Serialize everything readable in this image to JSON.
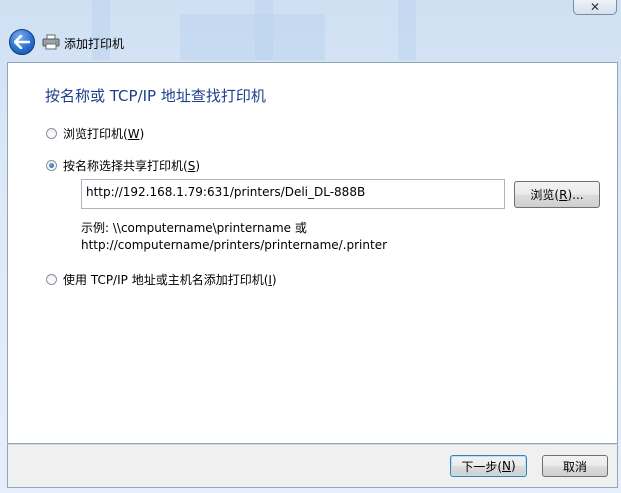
{
  "window": {
    "title": "添加打印机",
    "close_glyph": "✕"
  },
  "icons": {
    "back": "back-arrow-icon",
    "printer": "printer-icon",
    "close": "close-icon"
  },
  "colors": {
    "heading": "#1e3f8a",
    "accent": "#2a6fd1",
    "glass": "#dde9f7"
  },
  "main": {
    "heading": "按名称或 TCP/IP 地址查找打印机",
    "options": [
      {
        "label": "浏览打印机(",
        "key": "W",
        "suffix": ")",
        "checked": false
      },
      {
        "label": "按名称选择共享打印机(",
        "key": "S",
        "suffix": ")",
        "checked": true
      },
      {
        "label": "使用 TCP/IP 地址或主机名添加打印机(",
        "key": "I",
        "suffix": ")",
        "checked": false
      }
    ],
    "url_value": "http://192.168.1.79:631/printers/Deli_DL-888B",
    "browse": {
      "label": "浏览(",
      "key": "R",
      "suffix": ")..."
    },
    "example_line1": "示例: \\\\computername\\printername 或",
    "example_line2": "http://computername/printers/printername/.printer"
  },
  "footer": {
    "next": {
      "label": "下一步(",
      "key": "N",
      "suffix": ")"
    },
    "cancel": "取消"
  }
}
